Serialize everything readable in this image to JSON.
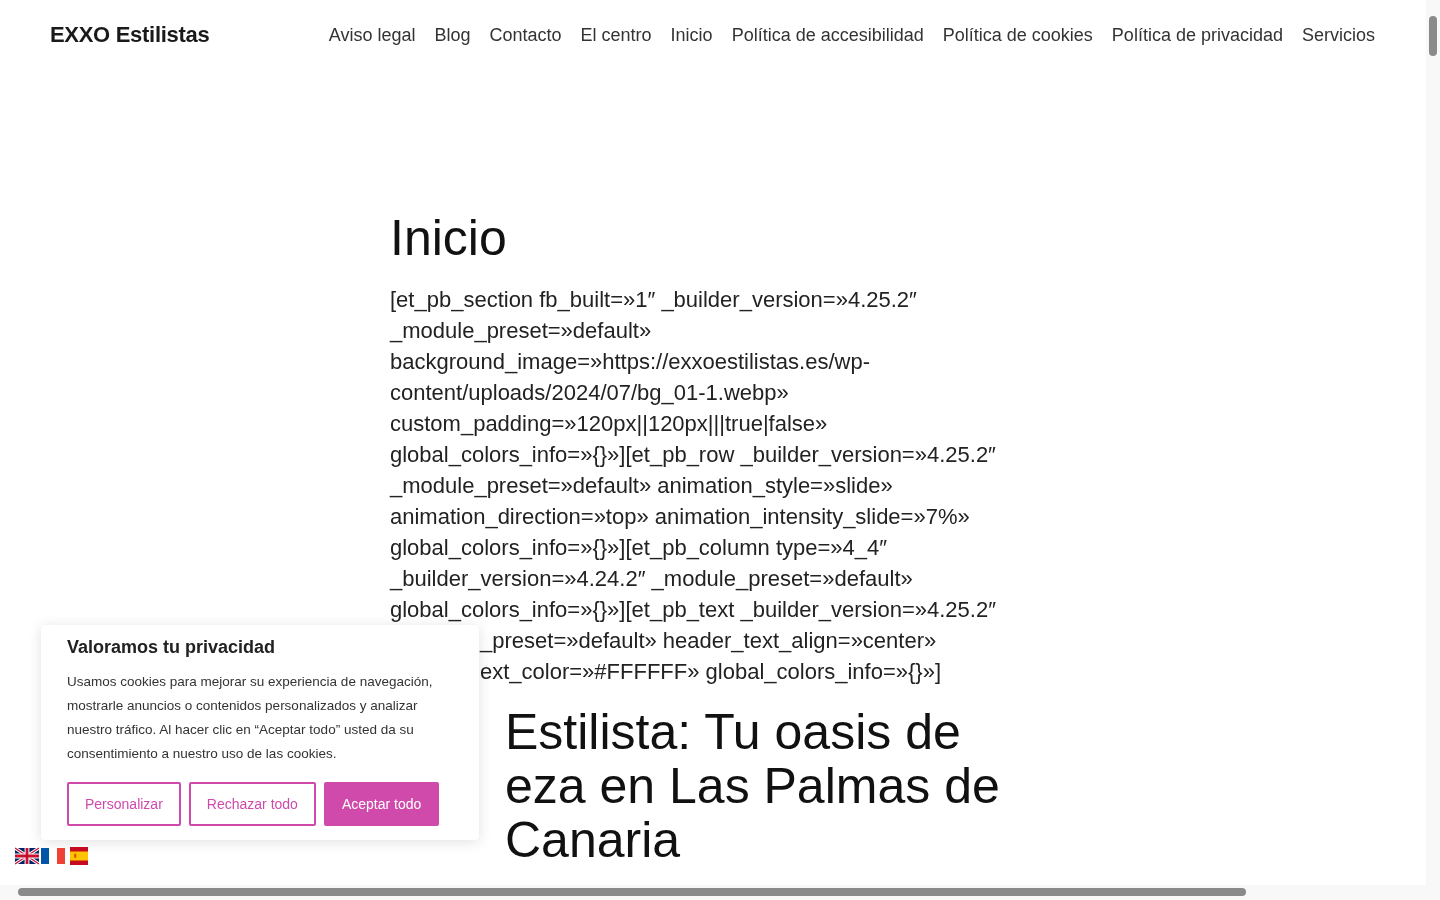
{
  "header": {
    "brand": "EXXO Estilistas",
    "nav": [
      "Aviso legal",
      "Blog",
      "Contacto",
      "El centro",
      "Inicio",
      "Política de accesibilidad",
      "Política de cookies",
      "Política de privacidad",
      "Servicios"
    ]
  },
  "page": {
    "title": "Inicio",
    "code_lines": [
      {
        "kind": "full",
        "text": "[et_pb_section fb_built=»1″ _builder_version=»4.25.2″"
      },
      {
        "kind": "full",
        "text": "_module_preset=»default»"
      },
      {
        "kind": "full",
        "text": "background_image=»https://exxoestilistas.es/wp-"
      },
      {
        "kind": "full",
        "text": "content/uploads/2024/07/bg_01-1.webp»"
      },
      {
        "kind": "full",
        "text": "custom_padding=»120px||120px|||true|false»"
      },
      {
        "kind": "full",
        "text": "global_colors_info=»{}»][et_pb_row _builder_version=»4.25.2″"
      },
      {
        "kind": "full",
        "text": "_module_preset=»default» animation_style=»slide»"
      },
      {
        "kind": "full",
        "text": "animation_direction=»top» animation_intensity_slide=»7%»"
      },
      {
        "kind": "full",
        "text": "global_colors_info=»{}»][et_pb_column type=»4_4″"
      },
      {
        "kind": "full",
        "text": "_builder_version=»4.24.2″ _module_preset=»default»"
      },
      {
        "kind": "full",
        "text": "global_colors_info=»{}»][et_pb_text _builder_version=»4.25.2″"
      },
      {
        "kind": "partial",
        "text": "_preset=»default» header_text_align=»center»"
      },
      {
        "kind": "partial",
        "text": "ext_color=»#FFFFFF» global_colors_info=»{}»]"
      }
    ],
    "heading_lines": [
      {
        "kind": "partial",
        "text": "Estilista: Tu oasis de"
      },
      {
        "kind": "partial",
        "text": "eza en Las Palmas de"
      },
      {
        "kind": "partial",
        "text": "Canaria"
      }
    ]
  },
  "cookie_banner": {
    "title": "Valoramos tu privacidad",
    "text": "Usamos cookies para mejorar su experiencia de navegación, mostrarle anuncios o contenidos personalizados y analizar nuestro tráfico. Al hacer clic en “Aceptar todo” usted da su consentimiento a nuestro uso de las cookies.",
    "buttons": [
      {
        "kind": "outline",
        "label": "Personalizar"
      },
      {
        "kind": "outline",
        "label": "Rechazar todo"
      },
      {
        "kind": "filled",
        "label": "Aceptar todo"
      }
    ]
  }
}
